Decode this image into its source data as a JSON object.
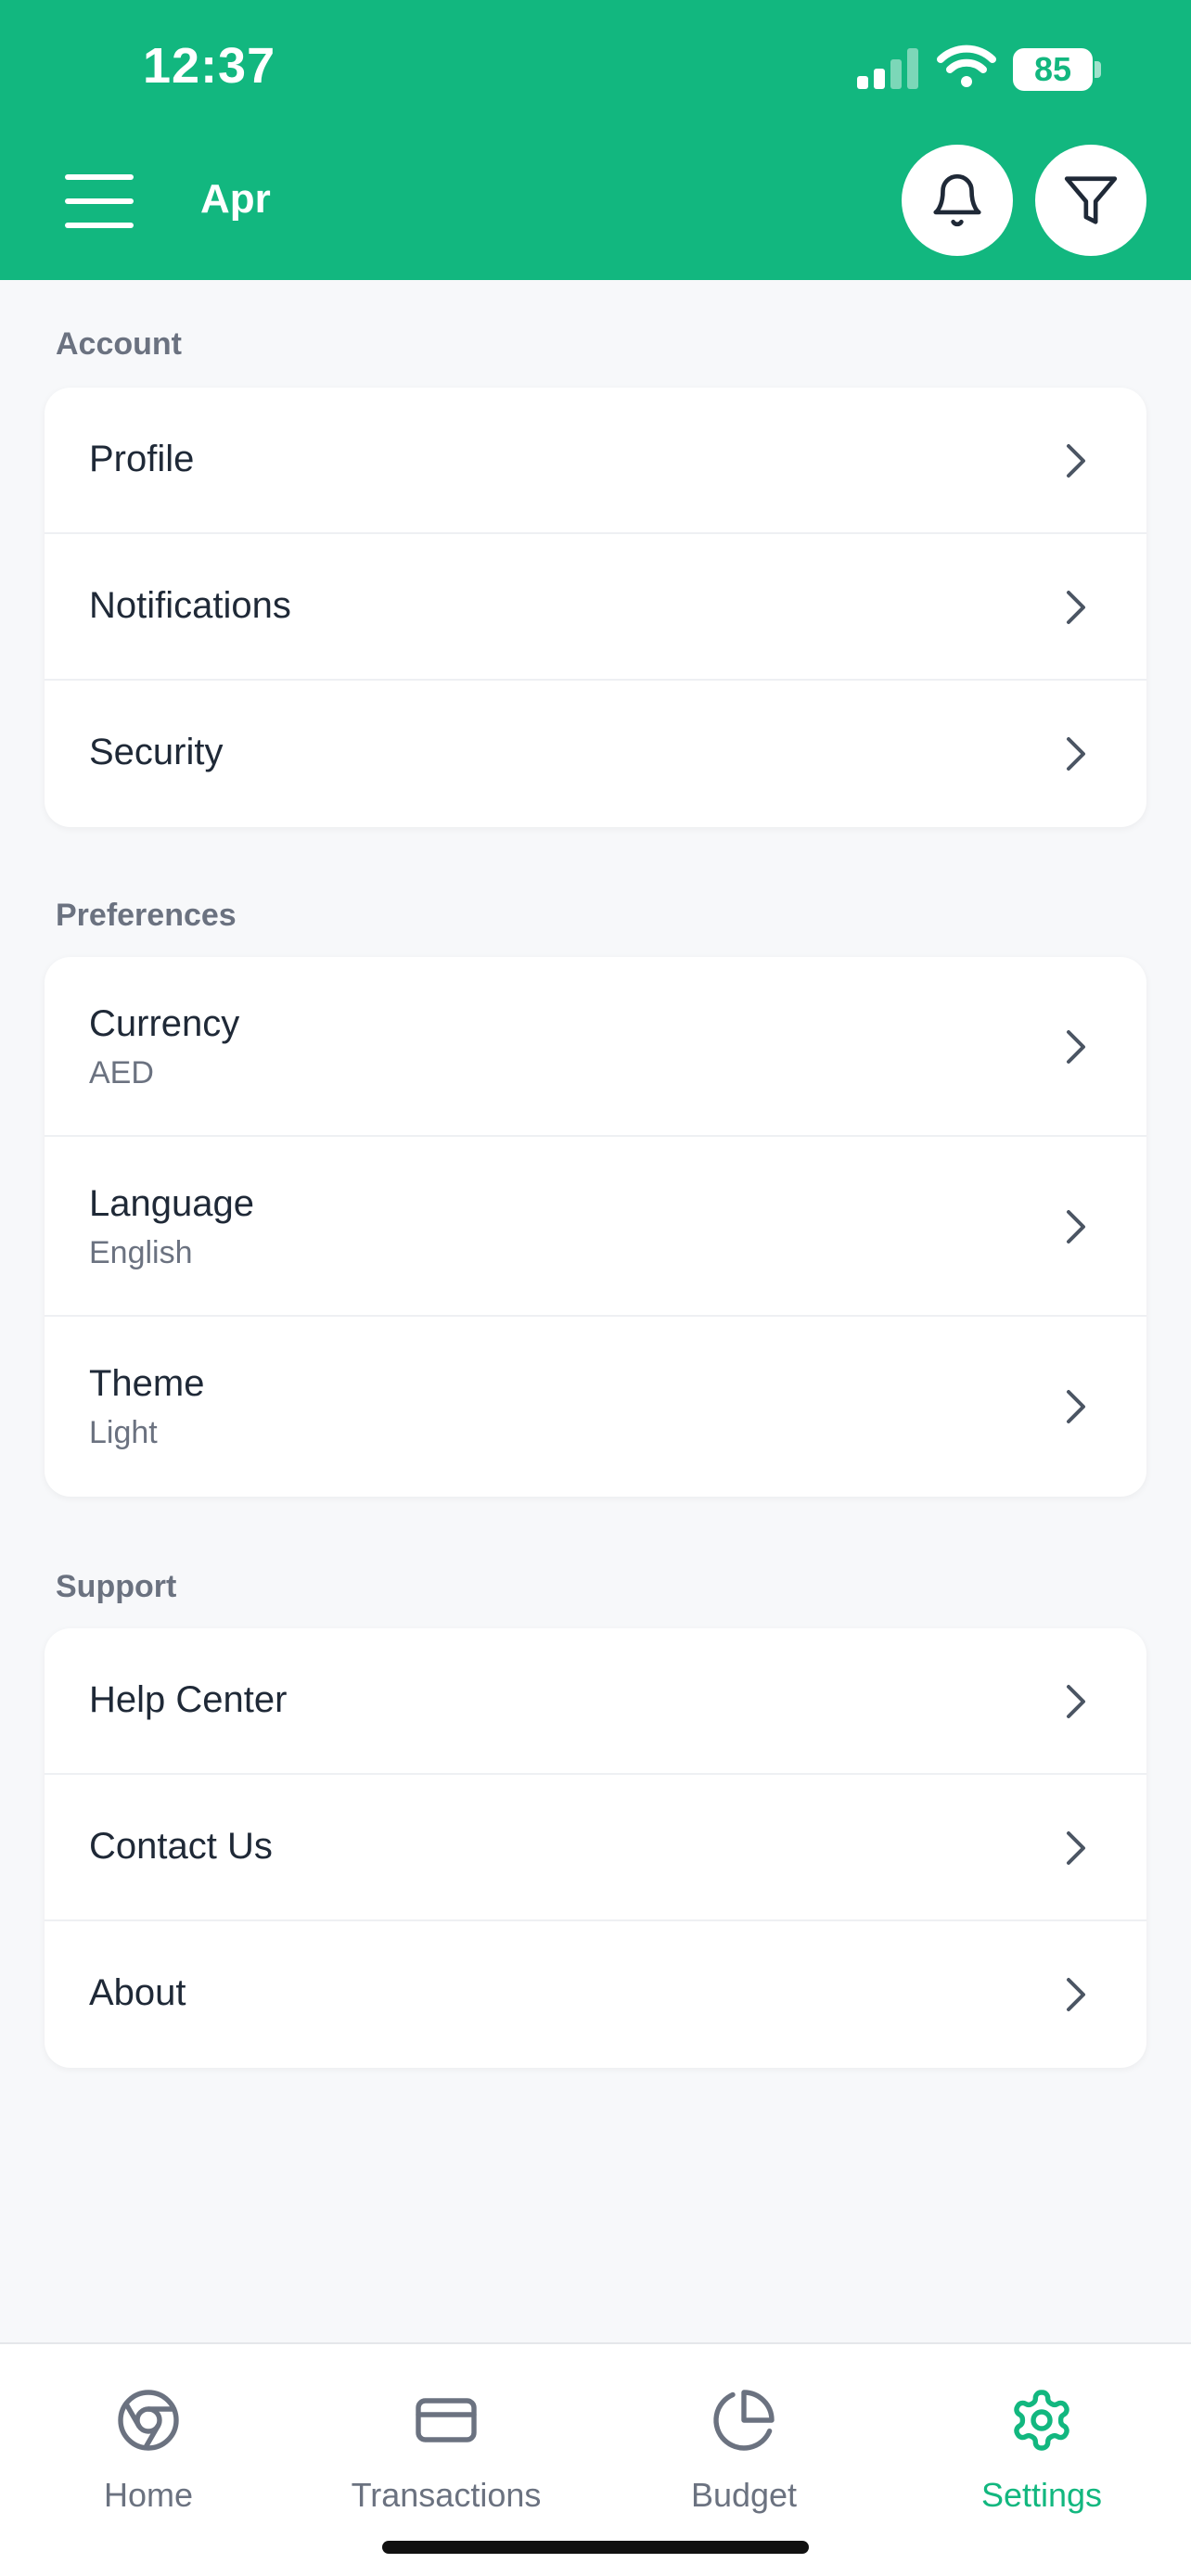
{
  "status_bar": {
    "time": "12:37",
    "battery": "85"
  },
  "header": {
    "title": "Apr"
  },
  "sections": [
    {
      "label": "Account",
      "items": [
        {
          "title": "Profile",
          "subtitle": ""
        },
        {
          "title": "Notifications",
          "subtitle": ""
        },
        {
          "title": "Security",
          "subtitle": ""
        }
      ]
    },
    {
      "label": "Preferences",
      "items": [
        {
          "title": "Currency",
          "subtitle": "AED"
        },
        {
          "title": "Language",
          "subtitle": "English"
        },
        {
          "title": "Theme",
          "subtitle": "Light"
        }
      ]
    },
    {
      "label": "Support",
      "items": [
        {
          "title": "Help Center",
          "subtitle": ""
        },
        {
          "title": "Contact Us",
          "subtitle": ""
        },
        {
          "title": "About",
          "subtitle": ""
        }
      ]
    }
  ],
  "bottom_nav": [
    {
      "label": "Home",
      "icon": "home-icon"
    },
    {
      "label": "Transactions",
      "icon": "card-icon"
    },
    {
      "label": "Budget",
      "icon": "pie-chart-icon"
    },
    {
      "label": "Settings",
      "icon": "gear-icon"
    }
  ],
  "colors": {
    "accent": "#12b77f",
    "text": "#1f2937",
    "muted": "#6b7280"
  }
}
